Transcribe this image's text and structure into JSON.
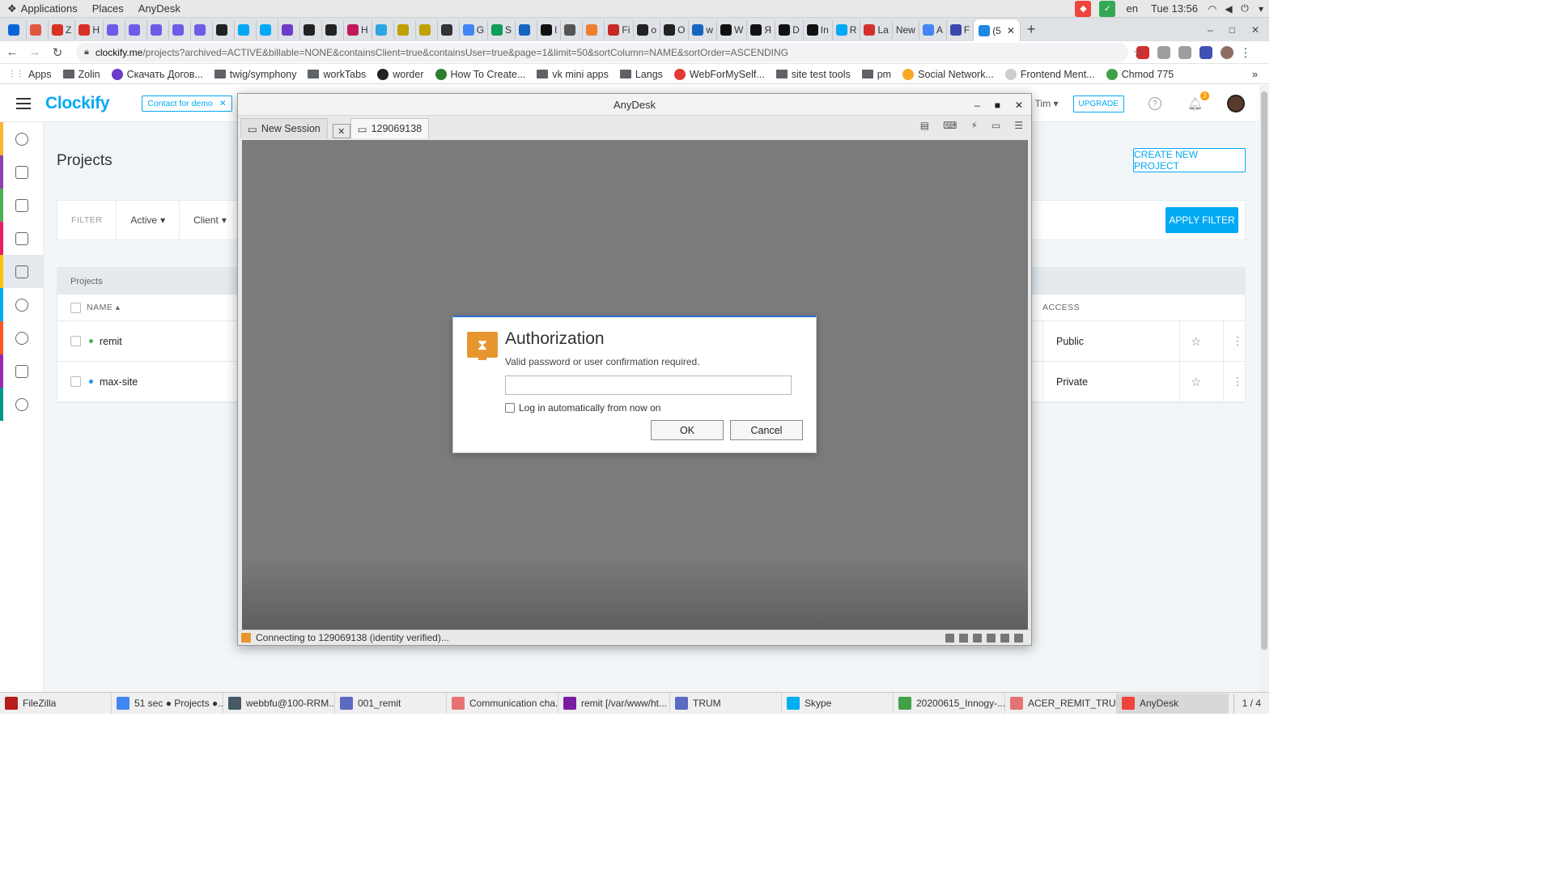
{
  "topbar": {
    "menus": [
      "Applications",
      "Places",
      "AnyDesk"
    ],
    "lang": "en",
    "clock": "Tue 13:56"
  },
  "browser": {
    "tabs": [
      {
        "label": "",
        "color": "#0a64d8"
      },
      {
        "label": "",
        "color": "#e2553f"
      },
      {
        "label": "Z",
        "color": "#d93025"
      },
      {
        "label": "H",
        "color": "#d93025"
      },
      {
        "label": "",
        "color": "#6d5ce8"
      },
      {
        "label": "",
        "color": "#6d5ce8"
      },
      {
        "label": "",
        "color": "#6d5ce8"
      },
      {
        "label": "",
        "color": "#6d5ce8"
      },
      {
        "label": "",
        "color": "#6d5ce8"
      },
      {
        "label": "",
        "color": "#222222"
      },
      {
        "label": "",
        "color": "#03a9f4"
      },
      {
        "label": "",
        "color": "#03a9f4"
      },
      {
        "label": "",
        "color": "#6d3cc8"
      },
      {
        "label": "",
        "color": "#222222"
      },
      {
        "label": "",
        "color": "#222222"
      },
      {
        "label": "H",
        "color": "#c2185b"
      },
      {
        "label": "",
        "color": "#2ca5e0"
      },
      {
        "label": "",
        "color": "#c0a000"
      },
      {
        "label": "",
        "color": "#c0a000"
      },
      {
        "label": "",
        "color": "#333333"
      },
      {
        "label": "G",
        "color": "#4285f4"
      },
      {
        "label": "S",
        "color": "#0f9d58"
      },
      {
        "label": "",
        "color": "#1565c0"
      },
      {
        "label": "I",
        "color": "#111111"
      },
      {
        "label": "",
        "color": "#555555"
      },
      {
        "label": "",
        "color": "#f08030"
      },
      {
        "label": "Fi",
        "color": "#c62828"
      },
      {
        "label": "o",
        "color": "#222222"
      },
      {
        "label": "O",
        "color": "#222222"
      },
      {
        "label": "w",
        "color": "#1565c0"
      },
      {
        "label": "W",
        "color": "#111111"
      },
      {
        "label": "Я",
        "color": "#111111"
      },
      {
        "label": "D",
        "color": "#111111"
      },
      {
        "label": "In",
        "color": "#111111"
      },
      {
        "label": "R",
        "color": "#03a9f4"
      },
      {
        "label": "La",
        "color": "#d32f2f"
      },
      {
        "label": "New",
        "color": ""
      },
      {
        "label": "A",
        "color": "#4285f4"
      },
      {
        "label": "F",
        "color": "#3949ab"
      },
      {
        "label": "(5",
        "color": "#1e88e5"
      }
    ],
    "new_tab": "+",
    "url_host": "clockify.me",
    "url_path": "/projects?archived=ACTIVE&billable=NONE&containsClient=true&containsUser=true&page=1&limit=50&sortColumn=NAME&sortOrder=ASCENDING",
    "bookmarks": [
      {
        "label": "Apps",
        "kind": "apps"
      },
      {
        "label": "Zolin",
        "kind": "folder"
      },
      {
        "label": "Скачать Догов...",
        "kind": "site",
        "color": "#6d3cc8"
      },
      {
        "label": "twig/symphony",
        "kind": "folder"
      },
      {
        "label": "workTabs",
        "kind": "folder"
      },
      {
        "label": "worder",
        "kind": "site",
        "color": "#222222"
      },
      {
        "label": "How To Create...",
        "kind": "site",
        "color": "#2e7d32"
      },
      {
        "label": "vk mini apps",
        "kind": "folder"
      },
      {
        "label": "Langs",
        "kind": "folder"
      },
      {
        "label": "WebForMySelf...",
        "kind": "site",
        "color": "#e53935"
      },
      {
        "label": "site test tools",
        "kind": "folder"
      },
      {
        "label": "pm",
        "kind": "folder"
      },
      {
        "label": "Social Network...",
        "kind": "site",
        "color": "#f9a825"
      },
      {
        "label": "Frontend Ment...",
        "kind": "site",
        "color": "#cccccc"
      },
      {
        "label": "Chmod 775",
        "kind": "site",
        "color": "#43a047"
      }
    ],
    "bookmarks_more": "»"
  },
  "clockify": {
    "logo": "Clockify",
    "demo_label": "Contact for demo",
    "workspace": "Tim",
    "upgrade": "UPGRADE",
    "notif_count": "3",
    "page_title": "Projects",
    "create_button": "CREATE NEW PROJECT",
    "filter_label": "FILTER",
    "filter_status": "Active",
    "filter_client": "Client",
    "apply_button": "APPLY FILTER",
    "table_caption": "Projects",
    "col_name": "NAME",
    "col_access": "ACCESS",
    "rows": [
      {
        "name": "remit",
        "dot": "#4caf50",
        "access": "Public"
      },
      {
        "name": "max-site",
        "dot": "#2196f3",
        "access": "Private"
      }
    ],
    "sidebar_colors": [
      "#f7b731",
      "#8e44ad",
      "#4caf50",
      "#e91e63",
      "#ffc107",
      "#03a9f4",
      "#ff5722",
      "#9c27b0",
      "#009688"
    ]
  },
  "anydesk": {
    "title": "AnyDesk",
    "tab_new": "New Session",
    "tab_session": "129069138",
    "status": "Connecting to 129069138 (identity verified)...",
    "dialog": {
      "title": "Authorization",
      "description": "Valid password or user confirmation required.",
      "password_value": "",
      "auto_login_label": "Log in automatically from now on",
      "ok": "OK",
      "cancel": "Cancel"
    }
  },
  "taskbar": {
    "items": [
      {
        "label": "FileZilla",
        "color": "#b71c1c"
      },
      {
        "label": "51 sec ● Projects ●...",
        "color": "#4285f4"
      },
      {
        "label": "webbfu@100-RRM...",
        "color": "#455a64"
      },
      {
        "label": "001_remit",
        "color": "#5c6bc0"
      },
      {
        "label": "Communication cha...",
        "color": "#e57373"
      },
      {
        "label": "remit [/var/www/ht...",
        "color": "#7b1fa2"
      },
      {
        "label": "TRUM",
        "color": "#5c6bc0"
      },
      {
        "label": "Skype",
        "color": "#00aff0"
      },
      {
        "label": "20200615_Innogy-...",
        "color": "#43a047"
      },
      {
        "label": "ACER_REMIT_TRU...",
        "color": "#e57373"
      },
      {
        "label": "AnyDesk",
        "color": "#ef443b"
      }
    ],
    "pager": "1 / 4"
  }
}
